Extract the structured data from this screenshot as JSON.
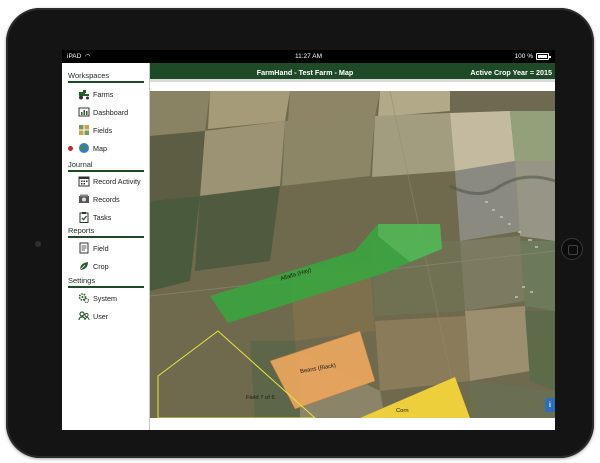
{
  "status_bar": {
    "carrier": "iPAD",
    "time": "11:27 AM",
    "battery": "100 %"
  },
  "header": {
    "title": "FarmHand - Test Farm - Map",
    "crop_year": "Active Crop Year = 2015"
  },
  "sidebar": {
    "workspaces": {
      "heading": "Workspaces",
      "items": [
        {
          "label": "Farms",
          "icon": "tractor-icon"
        },
        {
          "label": "Dashboard",
          "icon": "dashboard-icon"
        },
        {
          "label": "Fields",
          "icon": "fields-grid-icon"
        },
        {
          "label": "Map",
          "icon": "globe-icon",
          "active": true
        }
      ]
    },
    "journal": {
      "heading": "Journal",
      "items": [
        {
          "label": "Record Activity",
          "icon": "calendar-icon"
        },
        {
          "label": "Records",
          "icon": "records-icon"
        },
        {
          "label": "Tasks",
          "icon": "clipboard-check-icon"
        }
      ]
    },
    "reports": {
      "heading": "Reports",
      "items": [
        {
          "label": "Field",
          "icon": "field-report-icon"
        },
        {
          "label": "Crop",
          "icon": "leaf-icon"
        }
      ]
    },
    "settings": {
      "heading": "Settings",
      "items": [
        {
          "label": "System",
          "icon": "gears-icon"
        },
        {
          "label": "User",
          "icon": "users-icon"
        }
      ]
    }
  },
  "map": {
    "fields": [
      {
        "label": "Alfalfa (Hay)",
        "color": "#3aa53f"
      },
      {
        "label": "Beans (Black)",
        "color": "#e8a55f"
      },
      {
        "label": "Corn",
        "color": "#f3d43a"
      },
      {
        "label": "Field 7 of 6",
        "color": "#e6e63a"
      }
    ],
    "info_label": "i"
  },
  "colors": {
    "brand_green": "#1f4a28",
    "active_indicator": "#c22a2a"
  }
}
